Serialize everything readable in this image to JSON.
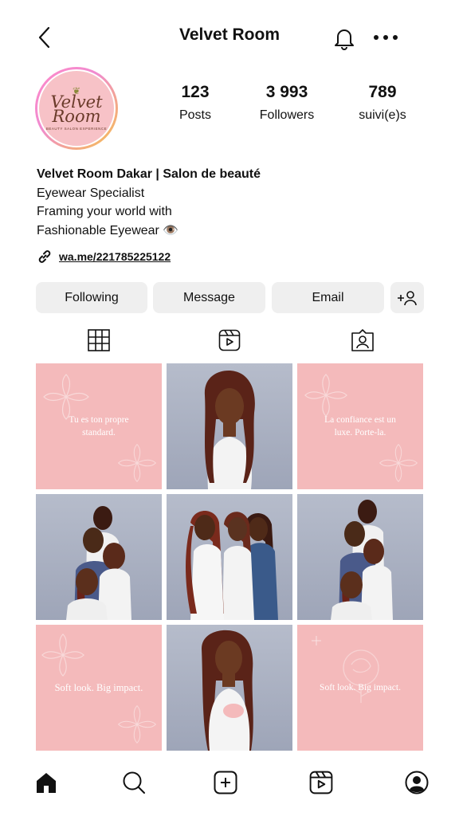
{
  "header": {
    "title": "Velvet Room",
    "back_icon": "chevron-left-icon",
    "bell_icon": "bell-icon",
    "more_icon": "more-horizontal-icon"
  },
  "profile": {
    "avatar_logo_line1": "Velvet",
    "avatar_logo_line2": "Room",
    "avatar_logo_sub": "BEAUTY SALON EXPERIENCE",
    "stats": [
      {
        "value": "123",
        "label": "Posts"
      },
      {
        "value": "3 993",
        "label": "Followers"
      },
      {
        "value": "789",
        "label": "suivi(e)s"
      }
    ],
    "name": "Velvet Room Dakar | Salon de beauté",
    "bio_lines": [
      "Eyewear Specialist",
      "Framing your world with",
      "Fashionable Eyewear 👁️"
    ],
    "link": "wa.me/221785225122"
  },
  "actions": {
    "following": "Following",
    "message": "Message",
    "email": "Email",
    "add_person_icon": "add-person-icon"
  },
  "tabs": [
    {
      "name": "grid",
      "icon": "grid-icon"
    },
    {
      "name": "reels",
      "icon": "reels-icon"
    },
    {
      "name": "tagged",
      "icon": "tagged-person-icon"
    }
  ],
  "posts": [
    {
      "type": "quote",
      "text": "Tu es ton propre standard."
    },
    {
      "type": "photo",
      "description": "single model portrait"
    },
    {
      "type": "quote",
      "text": "La confiance est un luxe. Porte-la."
    },
    {
      "type": "photo",
      "description": "group of models"
    },
    {
      "type": "photo",
      "description": "group of models"
    },
    {
      "type": "photo",
      "description": "group of models"
    },
    {
      "type": "quote",
      "text": "Soft look. Big impact."
    },
    {
      "type": "photo",
      "description": "single model portrait"
    },
    {
      "type": "quote",
      "text": "Soft look. Big impact."
    }
  ],
  "bottom_nav": [
    {
      "name": "home",
      "icon": "home-icon",
      "active": true
    },
    {
      "name": "search",
      "icon": "search-icon",
      "active": false
    },
    {
      "name": "create",
      "icon": "plus-square-icon",
      "active": false
    },
    {
      "name": "reels",
      "icon": "reels-icon",
      "active": false
    },
    {
      "name": "profile",
      "icon": "profile-icon",
      "active": false
    }
  ],
  "colors": {
    "quote_tile": "#f4babb",
    "button_bg": "#efefef",
    "avatar_ring_start": "#ff8ac8",
    "avatar_ring_end": "#f6c24a"
  }
}
